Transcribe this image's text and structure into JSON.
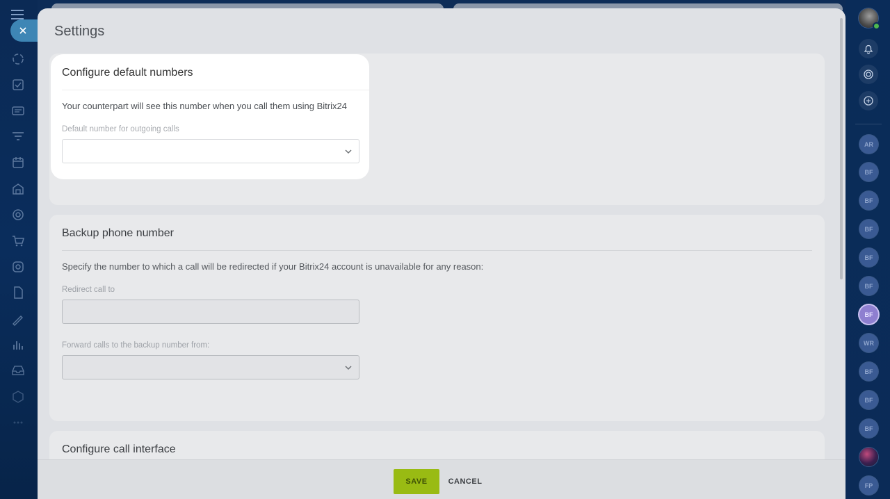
{
  "panel": {
    "title": "Settings"
  },
  "default_numbers": {
    "title": "Configure default numbers",
    "description": "Your counterpart will see this number when you call them using Bitrix24",
    "field_label": "Default number for outgoing calls",
    "field_value": ""
  },
  "backup": {
    "title": "Backup phone number",
    "description": "Specify the number to which a call will be redirected if your Bitrix24 account is unavailable for any reason:",
    "redirect_label": "Redirect call to",
    "redirect_value": "",
    "forward_label": "Forward calls to the backup number from:",
    "forward_value": ""
  },
  "call_interface": {
    "title": "Configure call interface"
  },
  "footer": {
    "save_label": "SAVE",
    "cancel_label": "CANCEL"
  },
  "right_bar": {
    "avatars": [
      "AR",
      "BF",
      "BF",
      "BF",
      "BF",
      "BF",
      "BF",
      "WR",
      "BF",
      "BF",
      "BF",
      "",
      "FP"
    ]
  },
  "colors": {
    "accent_save": "#99bb13",
    "sidebar_bg": "#0b2a55",
    "active_tab": "#3e86b5"
  }
}
